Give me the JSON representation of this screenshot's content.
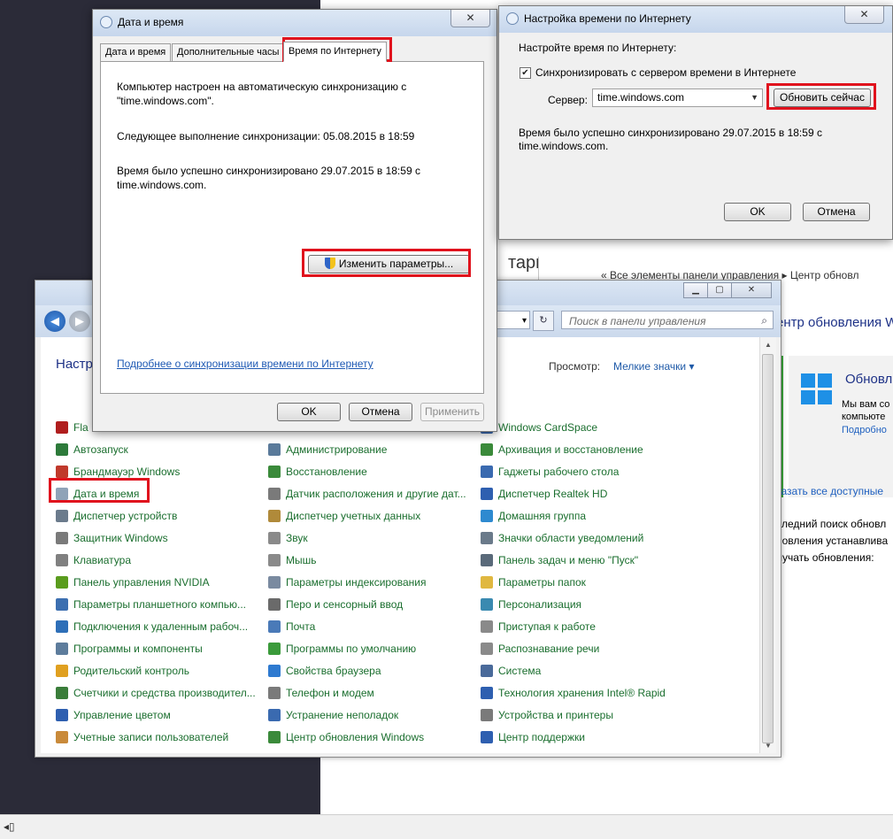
{
  "background": {
    "partial_title": "тари",
    "breadcrumb": "« Все элементы панели управления  ▸  Центр обновл",
    "update_window": {
      "title": "ентр обновления W",
      "panel_heading": "Обновл",
      "panel_text_1": "Мы вам со",
      "panel_text_2": "компьюте",
      "panel_link": "Подробно",
      "show_all_link": "казать все доступные",
      "line_1": "следний поиск обновл",
      "line_2": "новления устанавлива",
      "line_3": "лучать обновления:"
    },
    "bottom_glyph": "◂▯"
  },
  "control_panel": {
    "nav": {
      "address_tail": "▾",
      "refresh": "↻"
    },
    "search": {
      "placeholder": "Поиск в панели управления"
    },
    "heading": "Настр",
    "view_label": "Просмотр:",
    "view_value": "Мелкие значки ▾",
    "columns": [
      [
        {
          "label": "Fla",
          "icon": "flash-icon",
          "color": "#b01e1e"
        },
        {
          "label": "Автозапуск",
          "icon": "autoplay-icon",
          "color": "#2d7a3a"
        },
        {
          "label": "Брандмауэр Windows",
          "icon": "firewall-icon",
          "color": "#c0392b"
        },
        {
          "label": "Дата и время",
          "icon": "clock-icon",
          "color": "#8fa3b8"
        },
        {
          "label": "Диспетчер устройств",
          "icon": "device-manager-icon",
          "color": "#6b7b8c"
        },
        {
          "label": "Защитник Windows",
          "icon": "defender-icon",
          "color": "#7a7a7a"
        },
        {
          "label": "Клавиатура",
          "icon": "keyboard-icon",
          "color": "#808080"
        },
        {
          "label": "Панель управления NVIDIA",
          "icon": "nvidia-icon",
          "color": "#5a9c1e"
        },
        {
          "label": "Параметры планшетного компью...",
          "icon": "tablet-icon",
          "color": "#3c6fb0"
        },
        {
          "label": "Подключения к удаленным рабоч...",
          "icon": "remote-desktop-icon",
          "color": "#2e6fb8"
        },
        {
          "label": "Программы и компоненты",
          "icon": "programs-icon",
          "color": "#5d7c9c"
        },
        {
          "label": "Родительский контроль",
          "icon": "parental-icon",
          "color": "#e0a020"
        },
        {
          "label": "Счетчики и средства производител...",
          "icon": "performance-icon",
          "color": "#3a7d3a"
        },
        {
          "label": "Управление цветом",
          "icon": "color-management-icon",
          "color": "#2e5fb0"
        },
        {
          "label": "Учетные записи пользователей",
          "icon": "users-icon",
          "color": "#c98a3a"
        }
      ],
      [
        {
          "label": "Администрирование",
          "icon": "admin-tools-icon",
          "color": "#5a7a9a"
        },
        {
          "label": "Восстановление",
          "icon": "recovery-icon",
          "color": "#3a8a3a"
        },
        {
          "label": "Датчик расположения и другие дат...",
          "icon": "sensor-icon",
          "color": "#7a7a7a"
        },
        {
          "label": "Диспетчер учетных данных",
          "icon": "credential-icon",
          "color": "#b08a3a"
        },
        {
          "label": "Звук",
          "icon": "sound-icon",
          "color": "#8a8a8a"
        },
        {
          "label": "Мышь",
          "icon": "mouse-icon",
          "color": "#8a8a8a"
        },
        {
          "label": "Параметры индексирования",
          "icon": "indexing-icon",
          "color": "#7a8aa0"
        },
        {
          "label": "Перо и сенсорный ввод",
          "icon": "pen-icon",
          "color": "#6a6a6a"
        },
        {
          "label": "Почта",
          "icon": "mail-icon",
          "color": "#4a7ab8"
        },
        {
          "label": "Программы по умолчанию",
          "icon": "default-programs-icon",
          "color": "#3a9a3a"
        },
        {
          "label": "Свойства браузера",
          "icon": "browser-icon",
          "color": "#2e7ad0"
        },
        {
          "label": "Телефон и модем",
          "icon": "phone-icon",
          "color": "#7a7a7a"
        },
        {
          "label": "Устранение неполадок",
          "icon": "troubleshoot-icon",
          "color": "#3a6ab0"
        },
        {
          "label": "Центр обновления Windows",
          "icon": "windows-update-icon",
          "color": "#3a8a3a"
        }
      ],
      [
        {
          "label": "Windows CardSpace",
          "icon": "cardspace-icon",
          "color": "#3a6ab0"
        },
        {
          "label": "Архивация и восстановление",
          "icon": "backup-icon",
          "color": "#3a8a3a"
        },
        {
          "label": "Гаджеты рабочего стола",
          "icon": "gadgets-icon",
          "color": "#3a6ab0"
        },
        {
          "label": "Диспетчер Realtek HD",
          "icon": "realtek-icon",
          "color": "#2e5fb0"
        },
        {
          "label": "Домашняя группа",
          "icon": "homegroup-icon",
          "color": "#2e8ad0"
        },
        {
          "label": "Значки области уведомлений",
          "icon": "notification-icon",
          "color": "#6a7a8a"
        },
        {
          "label": "Панель задач и меню \"Пуск\"",
          "icon": "taskbar-icon",
          "color": "#5a6a7a"
        },
        {
          "label": "Параметры папок",
          "icon": "folder-icon",
          "color": "#e0b840"
        },
        {
          "label": "Персонализация",
          "icon": "personalization-icon",
          "color": "#3a8ab0"
        },
        {
          "label": "Приступая к работе",
          "icon": "getting-started-icon",
          "color": "#8a8a8a"
        },
        {
          "label": "Распознавание речи",
          "icon": "speech-icon",
          "color": "#8a8a8a"
        },
        {
          "label": "Система",
          "icon": "system-icon",
          "color": "#4a6a9a"
        },
        {
          "label": "Технология хранения Intel® Rapid",
          "icon": "intel-storage-icon",
          "color": "#2e5fb0"
        },
        {
          "label": "Устройства и принтеры",
          "icon": "printer-icon",
          "color": "#7a7a7a"
        },
        {
          "label": "Центр поддержки",
          "icon": "action-center-icon",
          "color": "#2e5fb0"
        }
      ]
    ]
  },
  "datetime_dialog": {
    "title": "Дата и время",
    "close": "✕",
    "tabs": [
      "Дата и время",
      "Дополнительные часы",
      "Время по Интернету"
    ],
    "line1": "Компьютер настроен на автоматическую синхронизацию с",
    "line2": "\"time.windows.com\".",
    "next_sync": "Следующее выполнение синхронизации: 05.08.2015 в 18:59",
    "last_sync_1": "Время было успешно синхронизировано 29.07.2015 в 18:59 с",
    "last_sync_2": "time.windows.com.",
    "change_button": "Изменить параметры...",
    "more_link": "Подробнее о синхронизации времени по Интернету",
    "ok": "OK",
    "cancel": "Отмена",
    "apply": "Применить"
  },
  "internet_time_dialog": {
    "title": "Настройка времени по Интернету",
    "close": "✕",
    "heading": "Настройте время по Интернету:",
    "sync_checkbox_label": "Синхронизировать с сервером времени в Интернете",
    "sync_checked": true,
    "server_label": "Сервер:",
    "server_value": "time.windows.com",
    "update_now": "Обновить сейчас",
    "status_1": "Время было успешно синхронизировано 29.07.2015 в 18:59 с",
    "status_2": "time.windows.com.",
    "ok": "OK",
    "cancel": "Отмена"
  },
  "colors": {
    "link_green": "#1a6e2e",
    "heading_blue": "#1e3287",
    "highlight_red": "#e0121d"
  }
}
